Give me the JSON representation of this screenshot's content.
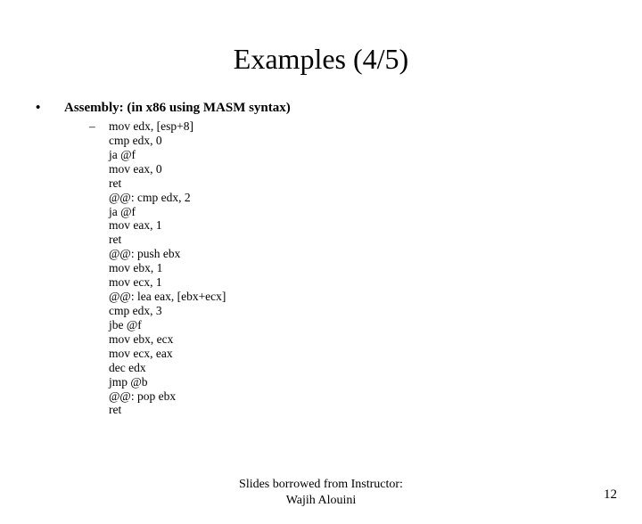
{
  "title": "Examples (4/5)",
  "bullet_label": "Assembly: (in x86 using MASM syntax)",
  "code": "mov edx, [esp+8]\ncmp edx, 0\nja @f\nmov eax, 0\nret\n@@: cmp edx, 2\nja @f\nmov eax, 1\nret\n@@: push ebx\nmov ebx, 1\nmov ecx, 1\n@@: lea eax, [ebx+ecx]\ncmp edx, 3\njbe @f\nmov ebx, ecx\nmov ecx, eax\ndec edx\njmp @b\n@@: pop ebx\nret",
  "footer_line1": "Slides borrowed from Instructor:",
  "footer_line2": "Wajih Alouini",
  "page_number": "12",
  "glyphs": {
    "bullet": "•",
    "dash": "–"
  }
}
